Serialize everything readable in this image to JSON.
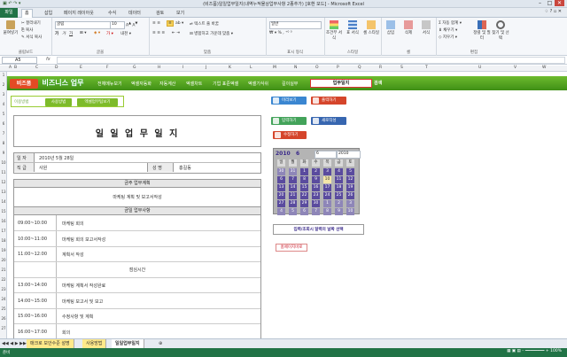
{
  "window": {
    "title": "(비즈폼)일일업무일지(내역누적물상업무사항 2종추가) [호환 모드] - Microsoft Excel"
  },
  "ribbon_tabs": [
    "파일",
    "홈",
    "삽입",
    "페이지 레이아웃",
    "수식",
    "데이터",
    "검토",
    "보기"
  ],
  "ribbon": {
    "clipboard": {
      "paste": "붙여넣기",
      "cut": "잘라내기",
      "copy": "복사",
      "format_painter": "서식 복사",
      "label": "클립보드"
    },
    "font": {
      "name": "굴림",
      "size": "10",
      "label": "글꼴"
    },
    "alignment": {
      "wrap": "텍스트 줄 바꿈",
      "merge": "병합하고 가운데 맞춤",
      "label": "맞춤"
    },
    "number": {
      "format": "일반",
      "label": "표시 형식"
    },
    "styles": {
      "conditional": "조건부 서식",
      "table": "표 서식",
      "cell": "셀 스타일",
      "label": "스타일"
    },
    "cells": {
      "insert": "삽입",
      "delete": "삭제",
      "format": "서식",
      "label": "셀"
    },
    "editing": {
      "autosum": "자동 합계",
      "fill": "채우기",
      "clear": "지우기",
      "sort": "정렬 및 필터",
      "find": "찾기 및 선택",
      "label": "편집"
    }
  },
  "formula_bar": {
    "name_box": "A5",
    "fx": "fx"
  },
  "columns": [
    "A",
    "B",
    "C",
    "D",
    "E",
    "F",
    "G",
    "H",
    "I",
    "J",
    "K",
    "L",
    "M",
    "N",
    "O",
    "P",
    "Q",
    "R",
    "S",
    "T",
    "U",
    "V",
    "W"
  ],
  "rows": [
    "1",
    "2",
    "3",
    "4",
    "5",
    "6",
    "7",
    "8",
    "9",
    "10",
    "11",
    "12",
    "13",
    "14",
    "15",
    "16",
    "17",
    "18",
    "19",
    "20",
    "21",
    "22",
    "23",
    "24",
    "25",
    "26",
    "27"
  ],
  "topnav": {
    "logo": "비즈폼",
    "brand": "비즈니스 업무",
    "items": [
      "전체메뉴보기",
      "엑셀자동화",
      "자동계산",
      "엑셀차트",
      "기업 표준엑셀",
      "엑셀기식쉬",
      "길이실무"
    ],
    "box": "업무일지",
    "go": "검색"
  },
  "usage": {
    "label": "이용방법",
    "buttons": [
      "사용방법",
      "엑셀업무팁보기"
    ]
  },
  "doc": {
    "title": "일 일 업 무 일 지",
    "date_label": "일   자",
    "date_value": "2010년 5월 28일",
    "position_label": "직   급",
    "position_value": "사원",
    "name_label": "성   명",
    "name_value": "홍길동",
    "today_plan_header": "금주 업무계획",
    "today_plan": "마케팅 계획 및 보고서작성",
    "today_work_header": "금일 업무사항",
    "entries": [
      {
        "time": "09:00~10:00",
        "task": "마케팅 회의"
      },
      {
        "time": "10:00~11:00",
        "task": "마케팅 회의 보고서작성"
      },
      {
        "time": "11:00~12:00",
        "task": "계획서 작성"
      },
      {
        "time": "",
        "task": "점심시간"
      },
      {
        "time": "13:00~14:00",
        "task": "마케팅 계획서 작성완료"
      },
      {
        "time": "14:00~15:00",
        "task": "마케팅 보고서 및 보고"
      },
      {
        "time": "15:00~16:00",
        "task": "수정사항 및 계획"
      },
      {
        "time": "16:00~17:00",
        "task": "회의"
      }
    ]
  },
  "right_panel": {
    "buttons": [
      {
        "label": "미리보기",
        "color": "#3a86d1"
      },
      {
        "label": "출력하기",
        "color": "#d5452b"
      },
      {
        "label": "입력하기",
        "color": "#43a35a"
      },
      {
        "label": "새로작성",
        "color": "#3766b0"
      },
      {
        "label": "수정하기",
        "color": "#d5452b"
      }
    ],
    "calendar": {
      "year": "2010",
      "month": "6",
      "weekdays": [
        "일",
        "월",
        "화",
        "수",
        "목",
        "금",
        "토"
      ],
      "days": [
        [
          "30",
          "31",
          "1",
          "2",
          "3",
          "4",
          "5"
        ],
        [
          "6",
          "7",
          "8",
          "9",
          "10",
          "11",
          "12"
        ],
        [
          "13",
          "14",
          "15",
          "16",
          "17",
          "18",
          "19"
        ],
        [
          "20",
          "21",
          "22",
          "23",
          "24",
          "25",
          "26"
        ],
        [
          "27",
          "28",
          "29",
          "30",
          "1",
          "2",
          "3"
        ],
        [
          "4",
          "5",
          "6",
          "7",
          "8",
          "9",
          "10"
        ]
      ]
    },
    "info": "입력/조회시 달력의 날짜 선택",
    "home_button": "홈페이지바로"
  },
  "sheet_tabs": [
    "매크로 보안수준 설명",
    "사용방법",
    "일일업무일지"
  ],
  "status": "준비"
}
